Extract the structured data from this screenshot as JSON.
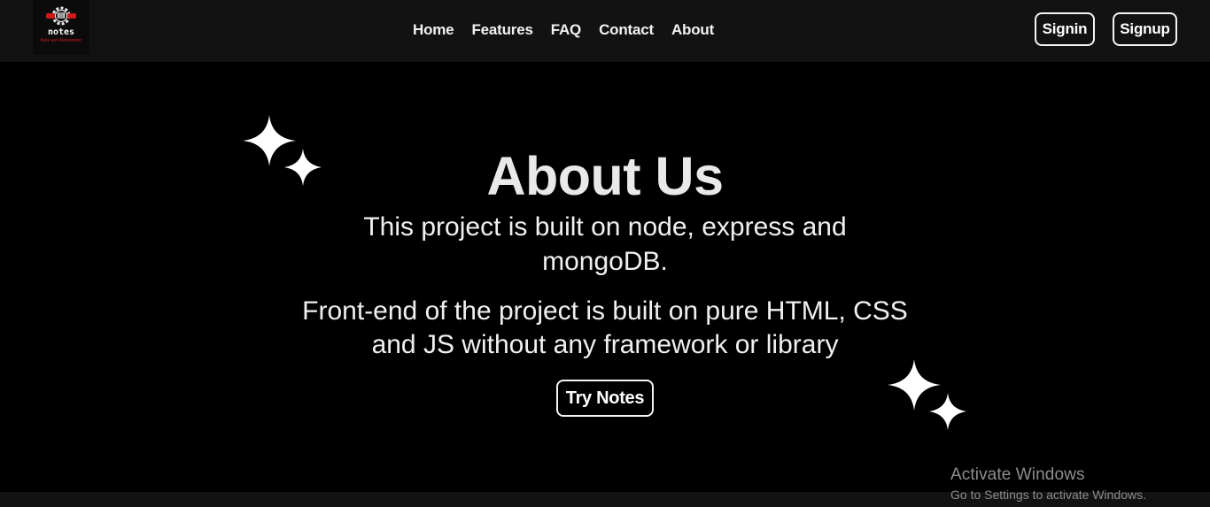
{
  "brand": {
    "name": "notes",
    "tagline": "Note and Remember",
    "colors": {
      "accent": "#d01818",
      "navbar": "#121212",
      "background": "#000000"
    }
  },
  "nav": {
    "links": [
      {
        "label": "Home"
      },
      {
        "label": "Features"
      },
      {
        "label": "FAQ"
      },
      {
        "label": "Contact"
      },
      {
        "label": "About"
      }
    ],
    "signin_label": "Signin",
    "signup_label": "Signup"
  },
  "hero": {
    "title": "About Us",
    "paragraph_1": "This project is built on node, express and mongoDB.",
    "paragraph_2": "Front-end of the project is built on pure HTML, CSS and JS without any framework or library",
    "cta_label": "Try Notes",
    "decor_icons": [
      "sparkles-icon",
      "sparkles-icon"
    ]
  },
  "watermark": {
    "title": "Activate Windows",
    "subtitle": "Go to Settings to activate Windows."
  }
}
